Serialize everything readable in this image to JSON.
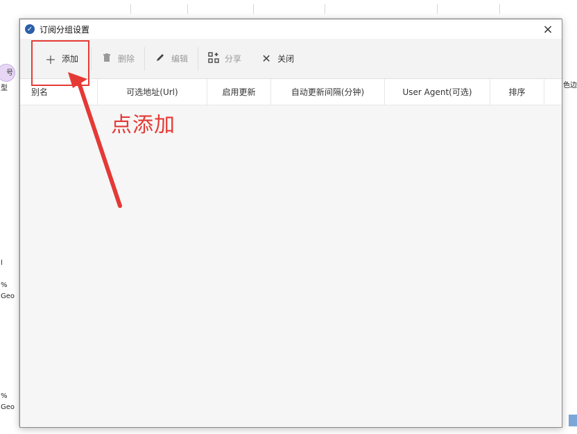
{
  "window": {
    "title": "订阅分组设置",
    "close_glyph": "×"
  },
  "toolbar": {
    "add": {
      "label": "添加",
      "icon": "plus-icon"
    },
    "delete": {
      "label": "删除",
      "icon": "trash-icon"
    },
    "edit": {
      "label": "编辑",
      "icon": "pencil-icon"
    },
    "share": {
      "label": "分享",
      "icon": "qr-icon"
    },
    "close": {
      "label": "关闭",
      "icon": "close-icon"
    }
  },
  "table": {
    "columns": [
      "别名",
      "可选地址(Url)",
      "启用更新",
      "自动更新间隔(分钟)",
      "User Agent(可选)",
      "排序"
    ],
    "rows": []
  },
  "annotation": {
    "label": "点添加",
    "color": "#e53935"
  },
  "background": {
    "left_pill": "号",
    "left_labels": [
      "型",
      "l",
      "%",
      "Geo",
      "%",
      "Geo"
    ],
    "right_label": "色边"
  }
}
